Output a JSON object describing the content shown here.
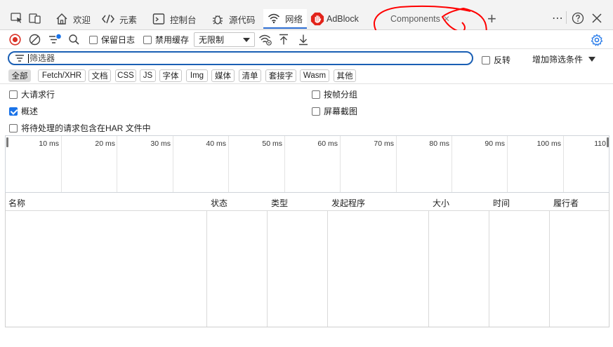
{
  "tabs": [
    {
      "label": "欢迎",
      "icon": "home-icon"
    },
    {
      "label": "元素",
      "icon": "code-icon"
    },
    {
      "label": "控制台",
      "icon": "console-icon"
    },
    {
      "label": "源代码",
      "icon": "bug-icon"
    },
    {
      "label": "网络",
      "icon": "wifi-icon",
      "active": true
    },
    {
      "label": "AdBlock",
      "icon": "adblock-icon"
    },
    {
      "label": "Components",
      "icon": ""
    }
  ],
  "toolbar": {
    "preserve_log": "保留日志",
    "disable_cache": "禁用缓存",
    "throttle": "无限制"
  },
  "filter": {
    "placeholder": "筛选器",
    "invert": "反转",
    "add_filter": "增加筛选条件"
  },
  "types": [
    "全部",
    "Fetch/XHR",
    "文档",
    "CSS",
    "JS",
    "字体",
    "Img",
    "媒体",
    "清单",
    "套接字",
    "Wasm",
    "其他"
  ],
  "options": {
    "large_rows": "大请求行",
    "group_by_frame": "按帧分组",
    "overview": "概述",
    "screenshots": "屏幕截图",
    "har_pending": "将待处理的请求包含在HAR 文件中"
  },
  "timeline": {
    "labels": [
      "10 ms",
      "20 ms",
      "30 ms",
      "40 ms",
      "50 ms",
      "60 ms",
      "70 ms",
      "80 ms",
      "90 ms",
      "100 ms",
      "110"
    ]
  },
  "table": {
    "columns": [
      "名称",
      "状态",
      "类型",
      "发起程序",
      "大小",
      "时间",
      "履行者"
    ]
  },
  "colors": {
    "accent": "#1a73e8",
    "record_red": "#d93025",
    "adblock_red": "#e2231a",
    "annotation_red": "#ff0000"
  }
}
